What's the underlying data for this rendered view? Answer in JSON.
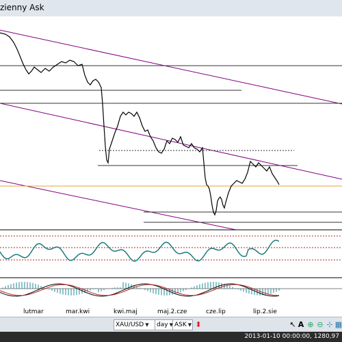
{
  "window": {
    "title": "zienny Ask"
  },
  "colors": {
    "price": "#000000",
    "channel": "#800080",
    "orange_line": "#e8a33a",
    "rsi": "#1f7a7a",
    "macd_hist": "#1a8a9a",
    "macd_signal": "#b22222",
    "separator": "#000000",
    "level_dashed": "#b22222",
    "status_bg": "#2b2b2b"
  },
  "time_axis": {
    "labels": [
      "lutmar",
      "mar.kwi",
      "kwi.maj",
      "maj.2.cze",
      "cze.lip",
      "lip.2.sie"
    ]
  },
  "toolbar": {
    "symbol": "XAU/USD",
    "timeframe": "day",
    "price_side": "ASK",
    "icons": [
      "arrow-up-down-icon",
      "cursor-icon",
      "text-icon",
      "zoom-in-icon",
      "zoom-out-icon",
      "crosshair-icon",
      "grid-icon"
    ]
  },
  "status_bar": {
    "datetime": "2013-01-10 00:00:00",
    "price": "1280,97"
  }
}
